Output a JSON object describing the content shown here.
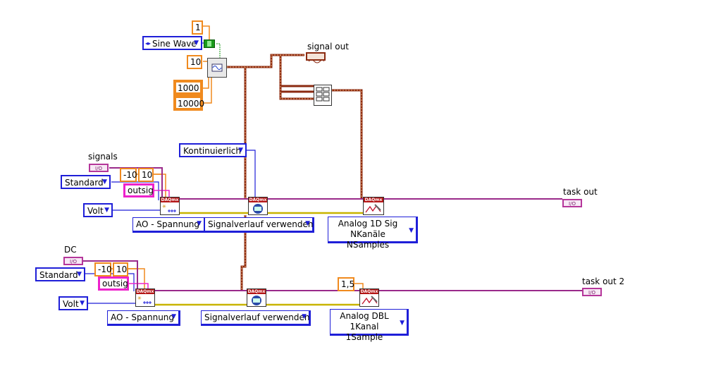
{
  "waveform": {
    "type_selector": "Sine Wave",
    "constant_1": "1",
    "constant_10": "10",
    "array_values": [
      "1000",
      "10000"
    ]
  },
  "signal_out": {
    "label": "signal out"
  },
  "timing": {
    "mode": "Kontinuierlich"
  },
  "channel1": {
    "label": "signals",
    "terminal_config": "Standard",
    "min": "-10",
    "max": "10",
    "name": "outsig",
    "units": "Volt",
    "create_type": "AO - Spannung",
    "timing_type": "Signalverlauf verwenden",
    "write_mode": "Analog 1D Sig NKanäle NSamples",
    "task_out": "task out"
  },
  "channel2": {
    "label": "DC",
    "terminal_config": "Standard",
    "min": "-10",
    "max": "10",
    "name": "outsig",
    "units": "Volt",
    "create_type": "AO - Spannung",
    "timing_type": "Signalverlauf verwenden",
    "write_value": "1,5",
    "write_mode": "Analog DBL 1Kanal 1Sample",
    "task_out": "task out 2"
  },
  "icons": {
    "daqmx_badge": "DAQmx",
    "io_badge": "I/O"
  },
  "colors": {
    "ring_blue": "#1f1fd8",
    "numeric_orange": "#f08a1e",
    "string_pink": "#ee22cc",
    "task_purple": "#b5369a",
    "waveform_brown": "#8b2a10",
    "error_yellow": "#c8b400"
  }
}
